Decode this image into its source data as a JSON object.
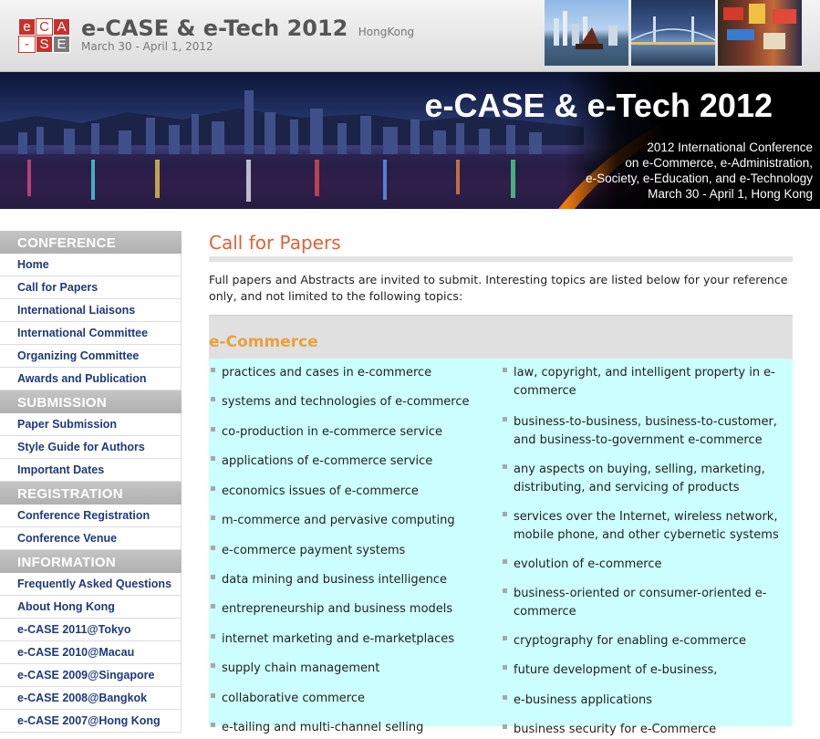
{
  "header": {
    "logo_letters": [
      "e",
      "C",
      "A",
      "-",
      "S",
      "E"
    ],
    "title": "e-CASE & e-Tech 2012",
    "location": "HongKong",
    "date": "March 30 - April 1, 2012"
  },
  "banner": {
    "title": "e-CASE & e-Tech 2012",
    "lines": [
      "2012 International Conference",
      "on e-Commerce, e-Administration,",
      "e-Society, e-Education, and e-Technology",
      "March 30 - April 1, Hong Kong"
    ]
  },
  "sidebar": {
    "sections": [
      {
        "heading": "CONFERENCE",
        "items": [
          "Home",
          "Call for Papers",
          "International Liaisons",
          "International Committee",
          "Organizing Committee",
          "Awards and Publication"
        ]
      },
      {
        "heading": "SUBMISSION",
        "items": [
          "Paper Submission",
          "Style Guide for Authors",
          "Important Dates"
        ]
      },
      {
        "heading": "REGISTRATION",
        "items": [
          "Conference Registration",
          "Conference Venue"
        ]
      },
      {
        "heading": "INFORMATION",
        "items": [
          "Frequently Asked Questions",
          "About Hong Kong",
          "e-CASE 2011@Tokyo",
          "e-CASE 2010@Macau",
          "e-CASE 2009@Singapore",
          "e-CASE 2008@Bangkok",
          "e-CASE 2007@Hong Kong"
        ]
      }
    ]
  },
  "main": {
    "title": "Call for Papers",
    "intro": "Full papers and Abstracts are invited to submit. Interesting topics are listed below for your reference only, and not limited to the following topics:",
    "category": "e-Commerce",
    "left_topics": [
      "practices and cases in e-commerce",
      "systems and technologies of e-commerce",
      "co-production in e-commerce service",
      "applications of e-commerce service",
      "economics issues of e-commerce",
      "m-commerce and pervasive computing",
      "e-commerce payment systems",
      "data mining and business intelligence",
      "entrepreneurship and business models",
      "internet marketing and e-marketplaces",
      "supply chain management",
      "collaborative commerce",
      "e-tailing and multi-channel selling"
    ],
    "right_topics": [
      "law, copyright, and intelligent property in e-commerce",
      "business-to-business, business-to-customer, and business-to-government e-commerce",
      "any aspects on buying, selling, marketing, distributing, and servicing of products",
      "services over the Internet, wireless network, mobile phone, and other cybernetic systems",
      "evolution of e-commerce",
      "business-oriented or consumer-oriented e-commerce",
      "cryptography for enabling e-commerce",
      "future development of e-business,",
      "e-business applications",
      "business security for e-Commerce"
    ]
  }
}
